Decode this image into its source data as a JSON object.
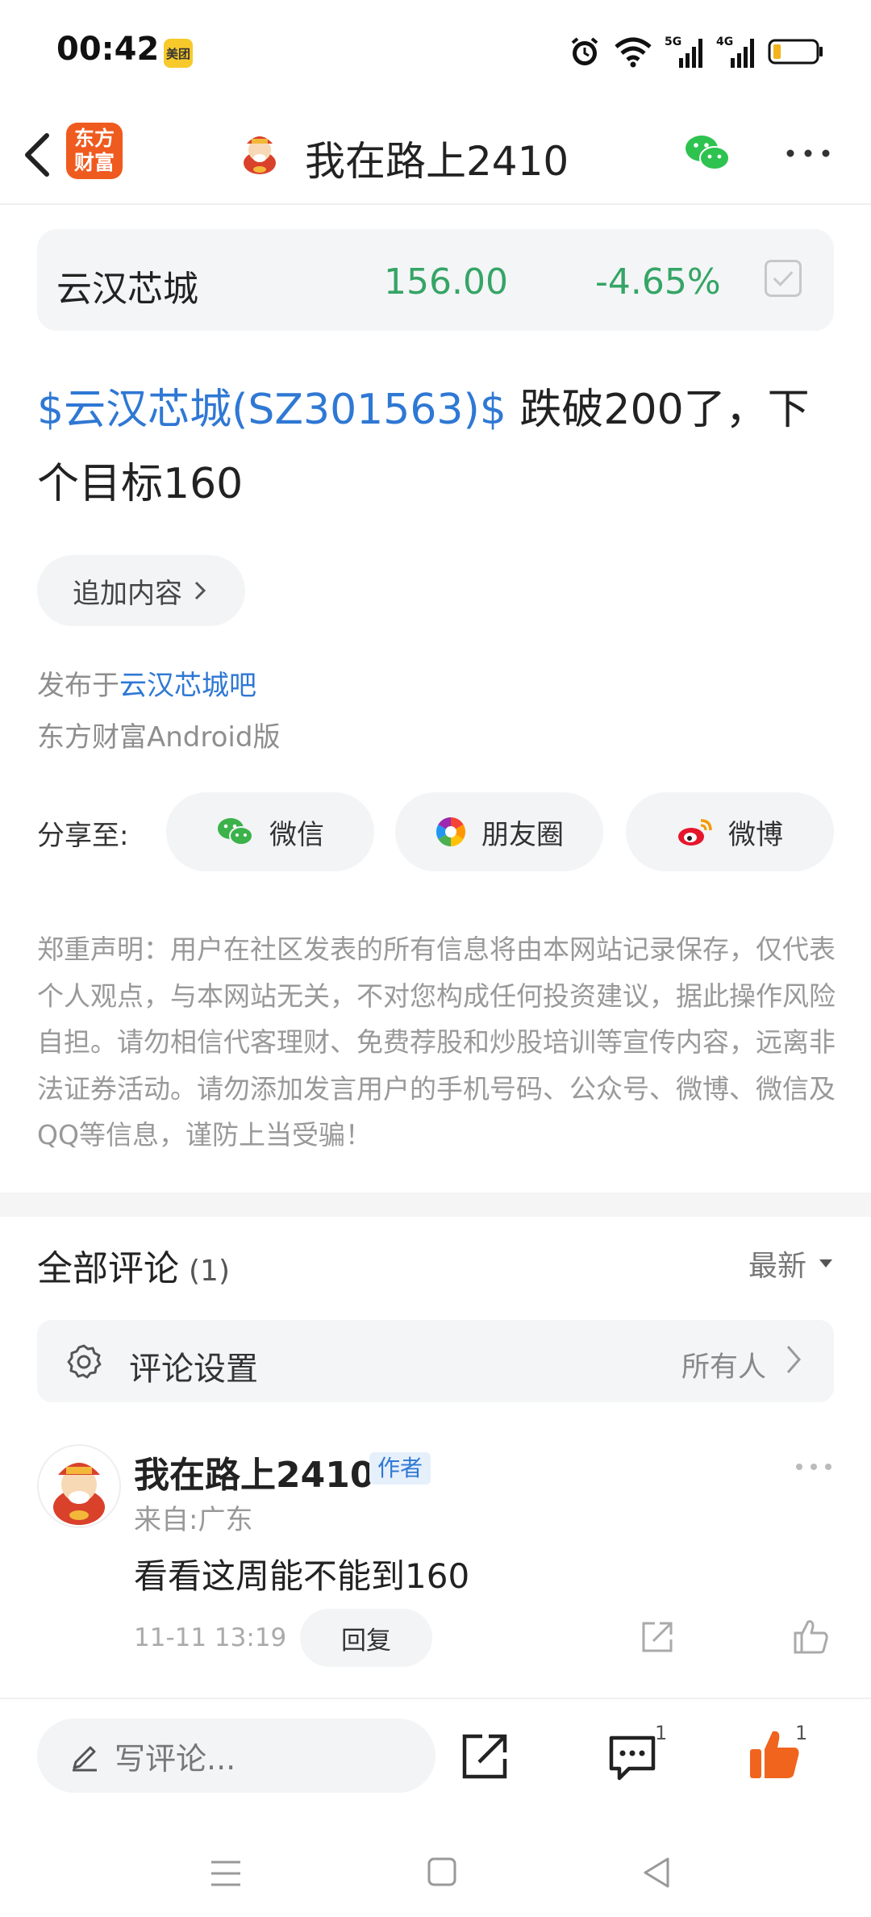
{
  "status_bar": {
    "time": "00:42",
    "badge": "美团",
    "icons": [
      "alarm-icon",
      "wifi-icon",
      "5g-signal-icon",
      "4g-signal-icon",
      "battery-icon"
    ],
    "signal_labels": [
      "5G",
      "4G"
    ]
  },
  "header": {
    "logo_text": "东方财富",
    "title": "我在路上2410"
  },
  "stock": {
    "name": "云汉芯城",
    "price": "156.00",
    "change": "-4.65%"
  },
  "post": {
    "link": "$云汉芯城(SZ301563)$",
    "text": " 跌破200了，下个目标160",
    "append_label": "追加内容"
  },
  "meta": {
    "published_prefix": "发布于",
    "bar_name": "云汉芯城吧",
    "client": "东方财富Android版"
  },
  "share": {
    "label": "分享至:",
    "options": [
      {
        "label": "微信",
        "icon": "wechat-icon"
      },
      {
        "label": "朋友圈",
        "icon": "moments-icon"
      },
      {
        "label": "微博",
        "icon": "weibo-icon"
      }
    ]
  },
  "disclaimer": "郑重声明：用户在社区发表的所有信息将由本网站记录保存，仅代表个人观点，与本网站无关，不对您构成任何投资建议，据此操作风险自担。请勿相信代客理财、免费荐股和炒股培训等宣传内容，远离非法证券活动。请勿添加发言用户的手机号码、公众号、微博、微信及QQ等信息，谨防上当受骗！",
  "comments": {
    "title": "全部评论",
    "count": "(1)",
    "sort_label": "最新",
    "settings_label": "评论设置",
    "settings_value": "所有人",
    "items": [
      {
        "user": "我在路上2410",
        "badge": "作者",
        "location": "来自:广东",
        "text": "看看这周能不能到160",
        "time": "11-11 13:19",
        "reply_label": "回复"
      }
    ]
  },
  "bottom_bar": {
    "write_placeholder": "写评论...",
    "comment_count": "1",
    "like_count": "1"
  },
  "colors": {
    "brand_orange": "#ef5a1f",
    "link_blue": "#2f78d4",
    "stock_green": "#35a566"
  }
}
